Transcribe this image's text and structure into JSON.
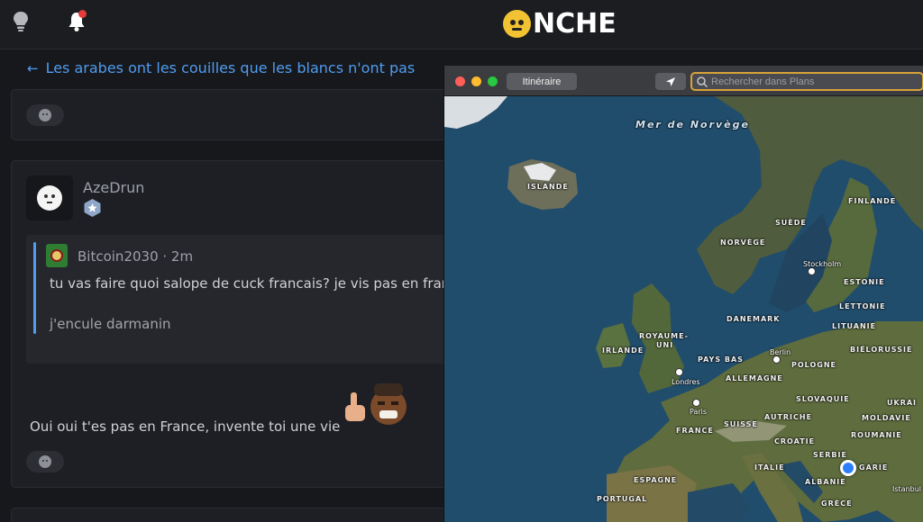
{
  "header": {
    "logo_text": "NCHE",
    "notification_color": "#e53b3b"
  },
  "topic": {
    "back_arrow": "←",
    "title": "Les arabes ont les couilles que les blancs n'ont pas"
  },
  "post": {
    "author": "AzeDrun",
    "quote": {
      "author_line": "Bitcoin2030 · 2m",
      "line1": "tu vas faire quoi salope de cuck francais? je vis pas en fran",
      "line2": "j'encule darmanin"
    },
    "reply_text": "Oui oui t'es pas en France, invente toi une vie"
  },
  "maps": {
    "route_button": "Itinéraire",
    "search_placeholder": "Rechercher dans Plans",
    "sea_label": "Mer de Norvège",
    "countries": [
      "ISLANDE",
      "FINLANDE",
      "SUÈDE",
      "NORVÈGE",
      "ESTONIE",
      "LETTONIE",
      "LITUANIE",
      "DANEMARK",
      "ROYAUME-",
      "UNI",
      "IRLANDE",
      "PAYS BAS",
      "BIÉLORUSSIE",
      "POLOGNE",
      "ALLEMAGNE",
      "SLOVAQUIE",
      "UKRAI",
      "AUTRICHE",
      "MOLDAVIE",
      "SUISSE",
      "FRANCE",
      "CROATIE",
      "ROUMANIE",
      "SERBIE",
      "ITALIE",
      "ALBANIE",
      "GARIE",
      "ESPAGNE",
      "PORTUGAL",
      "GRÈCE"
    ],
    "cities": [
      "Stockholm",
      "Berlin",
      "Londres",
      "Paris",
      "Istanbul"
    ]
  }
}
